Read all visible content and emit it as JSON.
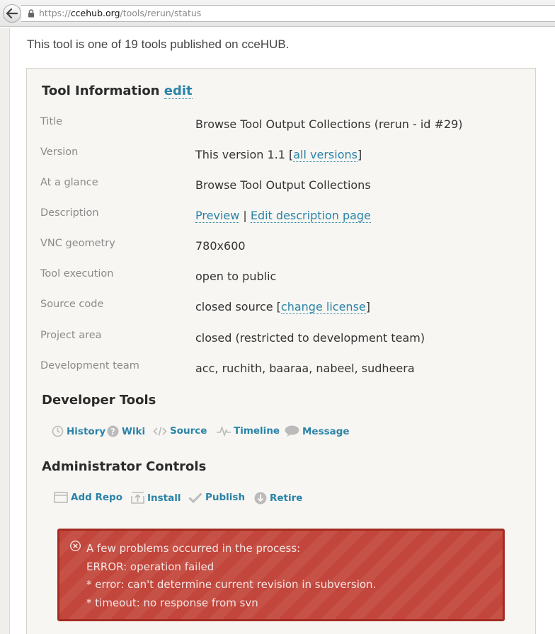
{
  "browser": {
    "url_scheme": "https://",
    "url_host": "ccehub.org",
    "url_path": "/tools/rerun/status"
  },
  "intro_text": "This tool is one of 19 tools published on cceHUB.",
  "tool_info": {
    "heading": "Tool Information",
    "edit_label": "edit",
    "rows": [
      {
        "label": "Title",
        "value": "Browse Tool Output Collections (rerun - id #29)"
      },
      {
        "label": "Version",
        "value_prefix": "This version 1.1 [",
        "link": "all versions",
        "value_suffix": "]"
      },
      {
        "label": "At a glance",
        "value": "Browse Tool Output Collections"
      },
      {
        "label": "Description",
        "link1": "Preview",
        "separator": " | ",
        "link2": "Edit description page"
      },
      {
        "label": "VNC geometry",
        "value": "780x600"
      },
      {
        "label": "Tool execution",
        "value": "open to public"
      },
      {
        "label": "Source code",
        "value_prefix": "closed source [",
        "link": "change license",
        "value_suffix": "]"
      },
      {
        "label": "Project area",
        "value": "closed (restricted to development team)"
      },
      {
        "label": "Development team",
        "value": "acc, ruchith, baaraa, nabeel, sudheera"
      }
    ]
  },
  "developer_tools": {
    "heading": "Developer Tools",
    "items": [
      {
        "label": "History",
        "icon": "clock-icon"
      },
      {
        "label": "Wiki",
        "icon": "question-icon"
      },
      {
        "label": "Source",
        "icon": "code-icon"
      },
      {
        "label": "Timeline",
        "icon": "pulse-icon"
      },
      {
        "label": "Message",
        "icon": "speech-bubble-icon"
      }
    ]
  },
  "admin_controls": {
    "heading": "Administrator Controls",
    "items": [
      {
        "label": "Add Repo",
        "icon": "window-icon"
      },
      {
        "label": "Install",
        "icon": "upload-icon"
      },
      {
        "label": "Publish",
        "icon": "checkmark-icon"
      },
      {
        "label": "Retire",
        "icon": "down-arrow-circle-icon"
      }
    ]
  },
  "error": {
    "lines": [
      "A few problems occurred in the process:",
      "ERROR: operation failed",
      "* error: can't determine current revision in subversion.",
      "* timeout: no response from svn"
    ],
    "colors": {
      "background": "#c2463c",
      "border": "#a32b22",
      "text": "#f6e5e3"
    }
  },
  "colors": {
    "link": "#2a83a8",
    "label": "#8a8a8a",
    "panel": "#f7f6f2"
  }
}
